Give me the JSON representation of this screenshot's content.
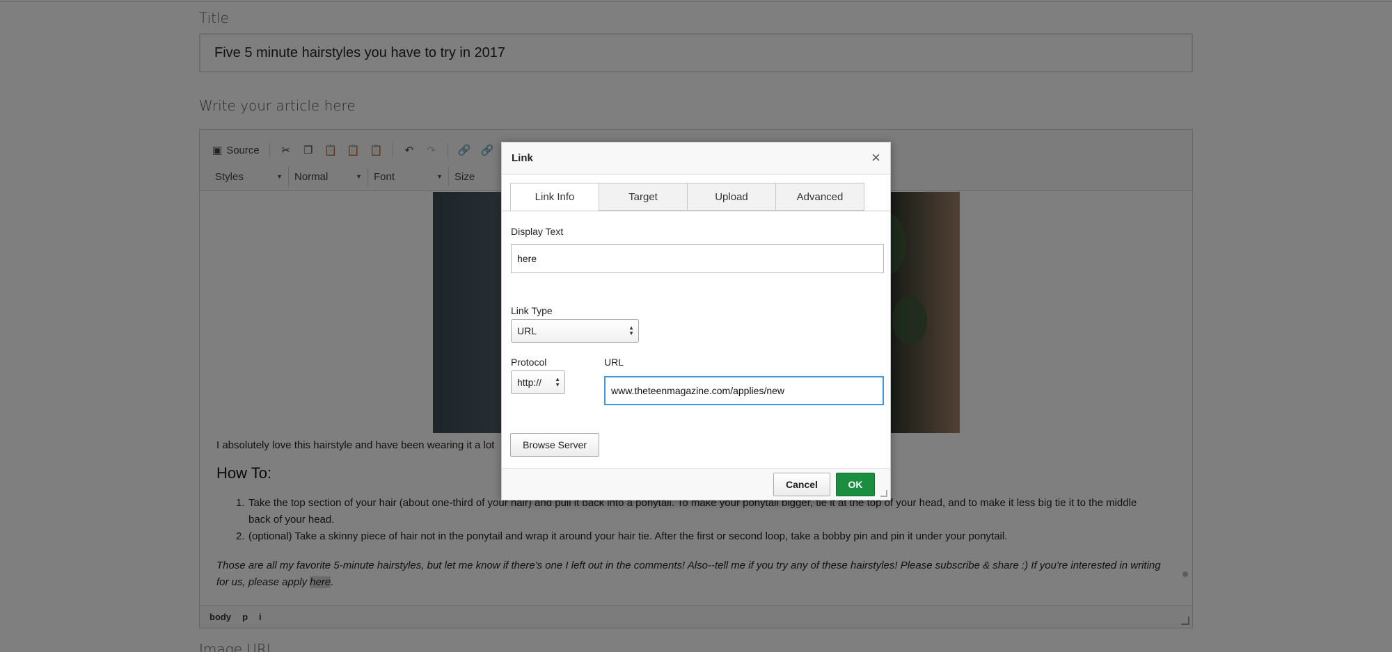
{
  "page": {
    "title_label": "Title",
    "title_value": "Five 5 minute hairstyles you have to try in 2017",
    "article_label": "Write your article here",
    "image_url_label": "Image URL"
  },
  "toolbar": {
    "source_label": "Source",
    "styles_label": "Styles",
    "format_label": "Normal",
    "font_label": "Font",
    "size_label": "Size"
  },
  "content": {
    "intro": "I absolutely love this hairstyle and have been wearing it a lot",
    "howto_heading": "How To:",
    "steps": [
      "Take the top section of your hair (about one-third of your hair) and pull it back into a ponytail. To make your ponytail bigger, tie it at the top of your head, and to make it less big tie it to the middle back of your head.",
      "(optional) Take a skinny piece of hair not in the ponytail and wrap it around your hair tie. After the first or second loop, take a bobby pin and pin it under your ponytail."
    ],
    "step_numbers": [
      "1.",
      "2."
    ],
    "closing_text": "Those are all my favorite 5-minute hairstyles, but let me know if there's one I left out in the comments! Also--tell me if you try any of these hairstyles! Please subscribe & share :) If you're interested in writing for us, please apply ",
    "closing_link": "here",
    "closing_end": "."
  },
  "element_path": [
    "body",
    "p",
    "i"
  ],
  "dialog": {
    "title": "Link",
    "close_glyph": "×",
    "tabs": [
      "Link Info",
      "Target",
      "Upload",
      "Advanced"
    ],
    "active_tab": "Link Info",
    "display_text_label": "Display Text",
    "display_text_value": "here",
    "link_type_label": "Link Type",
    "link_type_value": "URL",
    "protocol_label": "Protocol",
    "protocol_value": "http://",
    "url_label": "URL",
    "url_value": "www.theteenmagazine.com/applies/new",
    "browse_server_label": "Browse Server",
    "cancel_label": "Cancel",
    "ok_label": "OK"
  },
  "colors": {
    "ok_button": "#1a8d3e",
    "focus_border": "#3c98e0",
    "overlay": "rgba(0,0,0,0.5)"
  }
}
